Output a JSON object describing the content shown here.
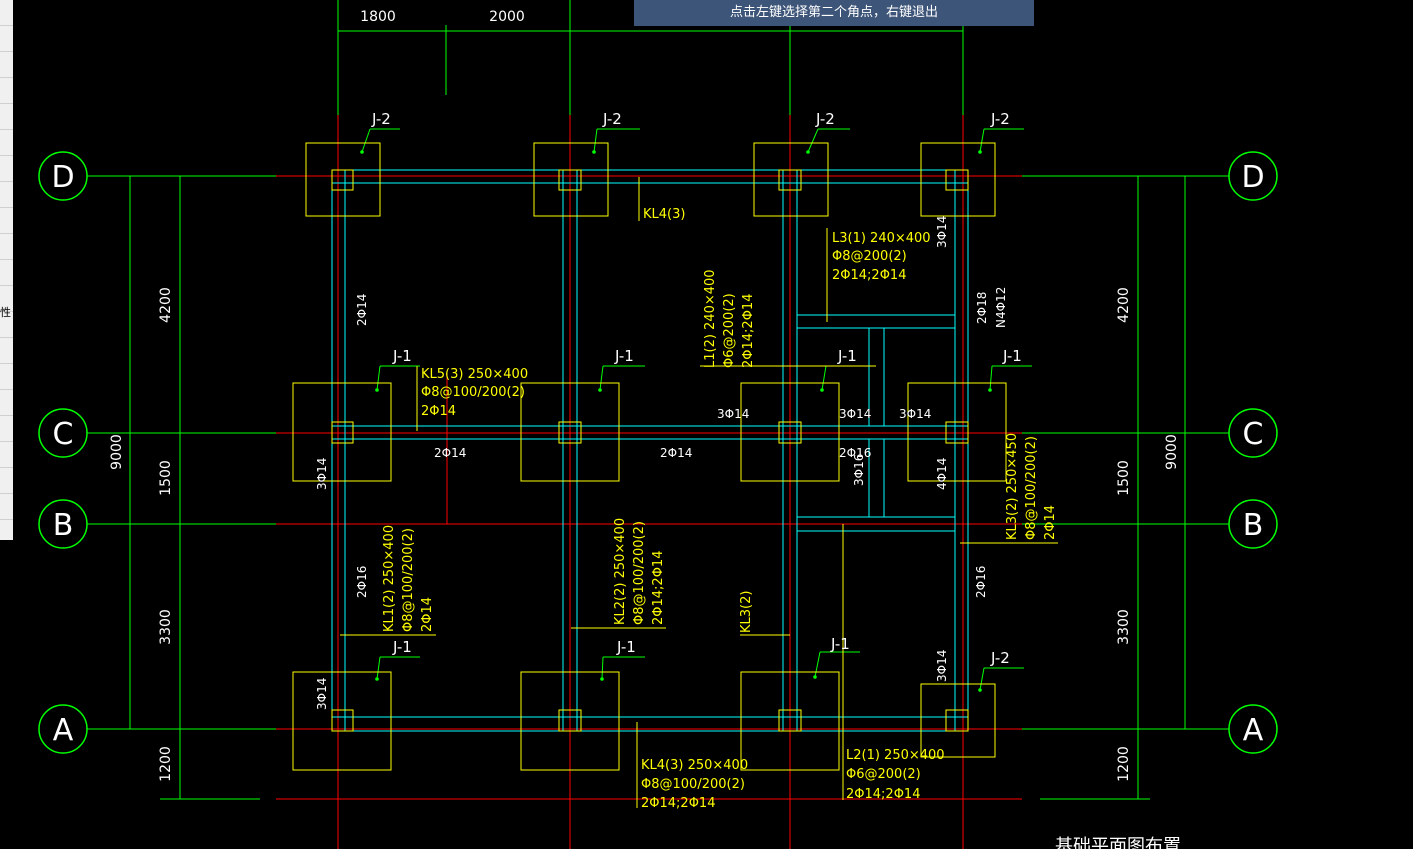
{
  "status_tip": "点击左键选择第二个角点，右键退出",
  "left_panel_glyph": "性",
  "axes": {
    "rows": [
      "D",
      "C",
      "B",
      "A"
    ],
    "dims_top": [
      "1800",
      "2000"
    ],
    "dims_left": [
      "4200",
      "1500",
      "3300",
      "1200"
    ],
    "dims_right": [
      "4200",
      "1500",
      "3300",
      "1200"
    ],
    "total_left": "9000",
    "total_right": "9000"
  },
  "footings": {
    "j2": "J-2",
    "j1": "J-1"
  },
  "beams": {
    "kl4_top": "KL4(3)",
    "l3_line1": "L3(1) 240×400",
    "l3_line2": "Φ8@200(2)",
    "l3_line3": "2Φ14;2Φ14",
    "l1_line1": "L1(2) 240×400",
    "l1_line2": "Φ6@200(2)",
    "l1_line3": "2Φ14;2Φ14",
    "kl5_line1": "KL5(3) 250×400",
    "kl5_line2": "Φ8@100/200(2)",
    "kl5_line3": "2Φ14",
    "kl1_line1": "KL1(2) 250×400",
    "kl1_line2": "Φ8@100/200(2)",
    "kl1_line3": "2Φ14",
    "kl2_line1": "KL2(2) 250×400",
    "kl2_line2": "Φ8@100/200(2)",
    "kl2_line3": "2Φ14;2Φ14",
    "kl3_mid": "KL3(2)",
    "kl3_line1": "KL3(2) 250×450",
    "kl3_line2": "Φ8@100/200(2)",
    "kl3_line3": "2Φ14",
    "kl4b_line1": "KL4(3) 250×400",
    "kl4b_line2": "Φ8@100/200(2)",
    "kl4b_line3": "2Φ14;2Φ14",
    "l2_line1": "L2(1) 250×400",
    "l2_line2": "Φ6@200(2)",
    "l2_line3": "2Φ14;2Φ14"
  },
  "rebar": {
    "r2_14": "2Φ14",
    "r3_14": "3Φ14",
    "r2_16": "2Φ16",
    "r3_16": "3Φ16",
    "r4_14": "4Φ14",
    "r2_18": "2Φ18",
    "n4_12": "N4Φ12"
  },
  "drawing_title": "基础平面图布置",
  "colors": {
    "grid_green": "#00ff00",
    "axis_red": "#ff0000",
    "beam_cyan": "#00ffff",
    "footing_yellow": "#ffff00",
    "tip_bg": "#3d5578"
  }
}
